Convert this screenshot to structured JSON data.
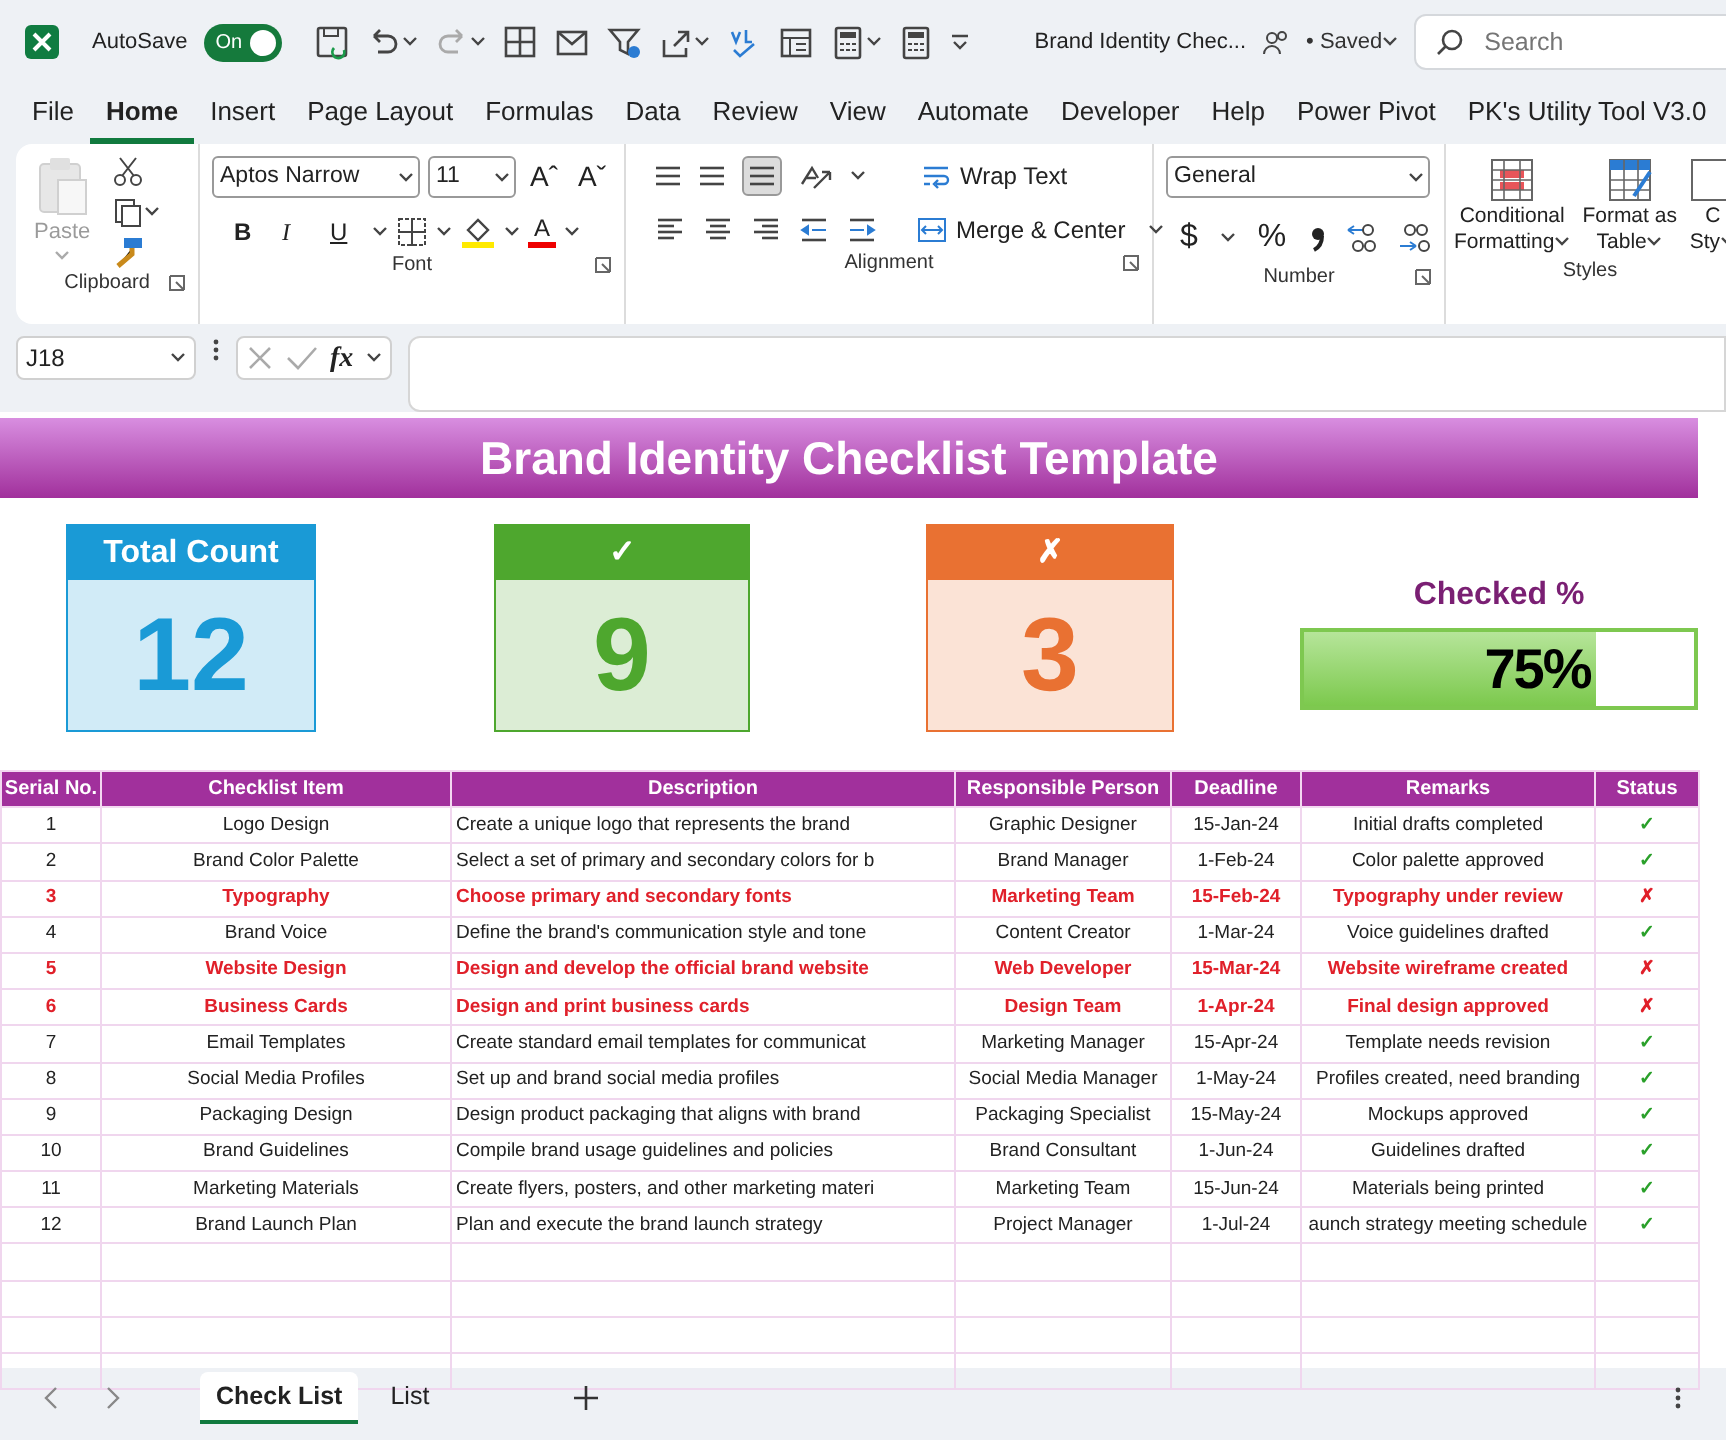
{
  "title_bar": {
    "autosave_label": "AutoSave",
    "autosave": {
      "label": "On",
      "on": true
    },
    "document_title": "Brand Identity Chec...",
    "save_state": "• Saved",
    "search": {
      "placeholder": "Search"
    }
  },
  "menu_tabs": [
    {
      "label": "File",
      "selected": false
    },
    {
      "label": "Home",
      "selected": true
    },
    {
      "label": "Insert",
      "selected": false
    },
    {
      "label": "Page Layout",
      "selected": false
    },
    {
      "label": "Formulas",
      "selected": false
    },
    {
      "label": "Data",
      "selected": false
    },
    {
      "label": "Review",
      "selected": false
    },
    {
      "label": "View",
      "selected": false
    },
    {
      "label": "Automate",
      "selected": false
    },
    {
      "label": "Developer",
      "selected": false
    },
    {
      "label": "Help",
      "selected": false
    },
    {
      "label": "Power Pivot",
      "selected": false
    },
    {
      "label": "PK's Utility Tool V3.0",
      "selected": false
    }
  ],
  "ribbon": {
    "clipboard": {
      "paste": {
        "label": "Paste",
        "disabled": true
      },
      "group": "Clipboard"
    },
    "font": {
      "font_name": "Aptos Narrow",
      "font_size": "11",
      "size_buttons": [
        "Aˆ",
        "Aˇ"
      ],
      "format_buttons": [
        "B",
        "I",
        "U"
      ],
      "font_color": "A",
      "group": "Font"
    },
    "alignment": {
      "wrap_text": "Wrap Text",
      "merge": "Merge & Center",
      "group": "Alignment"
    },
    "number": {
      "format": "General",
      "symbols": [
        "$",
        "%"
      ],
      "group": "Number"
    },
    "styles": {
      "buttons": [
        {
          "lines": [
            "Conditional",
            "Formatting"
          ]
        },
        {
          "lines": [
            "Format as",
            "Table"
          ]
        },
        {
          "lines": [
            "C",
            "Sty"
          ]
        }
      ],
      "group": "Styles"
    }
  },
  "formula_bar": {
    "name_box": "J18",
    "function_label": "fx"
  },
  "sheet": {
    "title": "Brand Identity Checklist Template",
    "cards": [
      {
        "label": "Total Count",
        "value": "12",
        "color": "#1a9ad6"
      },
      {
        "label": "✓",
        "value": "9",
        "color": "#4ea72e"
      },
      {
        "label": "✗",
        "value": "3",
        "color": "#e97132"
      }
    ],
    "progress": {
      "label": "Checked %",
      "level": 0.75,
      "reading": "75%"
    },
    "table": {
      "columns": [
        "Serial No.",
        "Checklist Item",
        "Description",
        "Responsible Person",
        "Deadline",
        "Remarks",
        "Status"
      ],
      "rows": [
        {
          "cells": [
            "1",
            "Logo Design",
            "Create a unique logo that represents the brand",
            "Graphic Designer",
            "15-Jan-24",
            "Initial drafts completed"
          ],
          "status": "✓",
          "complete": true
        },
        {
          "cells": [
            "2",
            "Brand Color Palette",
            "Select a set of primary and secondary colors for b",
            "Brand Manager",
            "1-Feb-24",
            "Color palette approved"
          ],
          "status": "✓",
          "complete": true
        },
        {
          "cells": [
            "3",
            "Typography",
            "Choose primary and secondary fonts",
            "Marketing Team",
            "15-Feb-24",
            "Typography under review"
          ],
          "status": "✗",
          "complete": false
        },
        {
          "cells": [
            "4",
            "Brand Voice",
            "Define the brand's communication style and tone",
            "Content Creator",
            "1-Mar-24",
            "Voice guidelines drafted"
          ],
          "status": "✓",
          "complete": true
        },
        {
          "cells": [
            "5",
            "Website Design",
            "Design and develop the official brand website",
            "Web Developer",
            "15-Mar-24",
            "Website wireframe created"
          ],
          "status": "✗",
          "complete": false
        },
        {
          "cells": [
            "6",
            "Business Cards",
            "Design and print business cards",
            "Design Team",
            "1-Apr-24",
            "Final design approved"
          ],
          "status": "✗",
          "complete": false
        },
        {
          "cells": [
            "7",
            "Email Templates",
            "Create standard email templates for communicat",
            "Marketing Manager",
            "15-Apr-24",
            "Template needs revision"
          ],
          "status": "✓",
          "complete": true
        },
        {
          "cells": [
            "8",
            "Social Media Profiles",
            "Set up and brand social media profiles",
            "Social Media Manager",
            "1-May-24",
            "Profiles created, need branding"
          ],
          "status": "✓",
          "complete": true
        },
        {
          "cells": [
            "9",
            "Packaging Design",
            "Design product packaging that aligns with brand",
            "Packaging Specialist",
            "15-May-24",
            "Mockups approved"
          ],
          "status": "✓",
          "complete": true
        },
        {
          "cells": [
            "10",
            "Brand Guidelines",
            "Compile brand usage guidelines and policies",
            "Brand Consultant",
            "1-Jun-24",
            "Guidelines drafted"
          ],
          "status": "✓",
          "complete": true
        },
        {
          "cells": [
            "11",
            "Marketing Materials",
            "Create flyers, posters, and other marketing materi",
            "Marketing Team",
            "15-Jun-24",
            "Materials being printed"
          ],
          "status": "✓",
          "complete": true
        },
        {
          "cells": [
            "12",
            "Brand Launch Plan",
            "Plan and execute the brand launch strategy",
            "Project Manager",
            "1-Jul-24",
            "aunch strategy meeting schedule"
          ],
          "status": "✓",
          "complete": true
        }
      ]
    }
  },
  "sheet_tabs": [
    {
      "label": "Check List",
      "selected": true
    },
    {
      "label": "List",
      "selected": false
    }
  ]
}
